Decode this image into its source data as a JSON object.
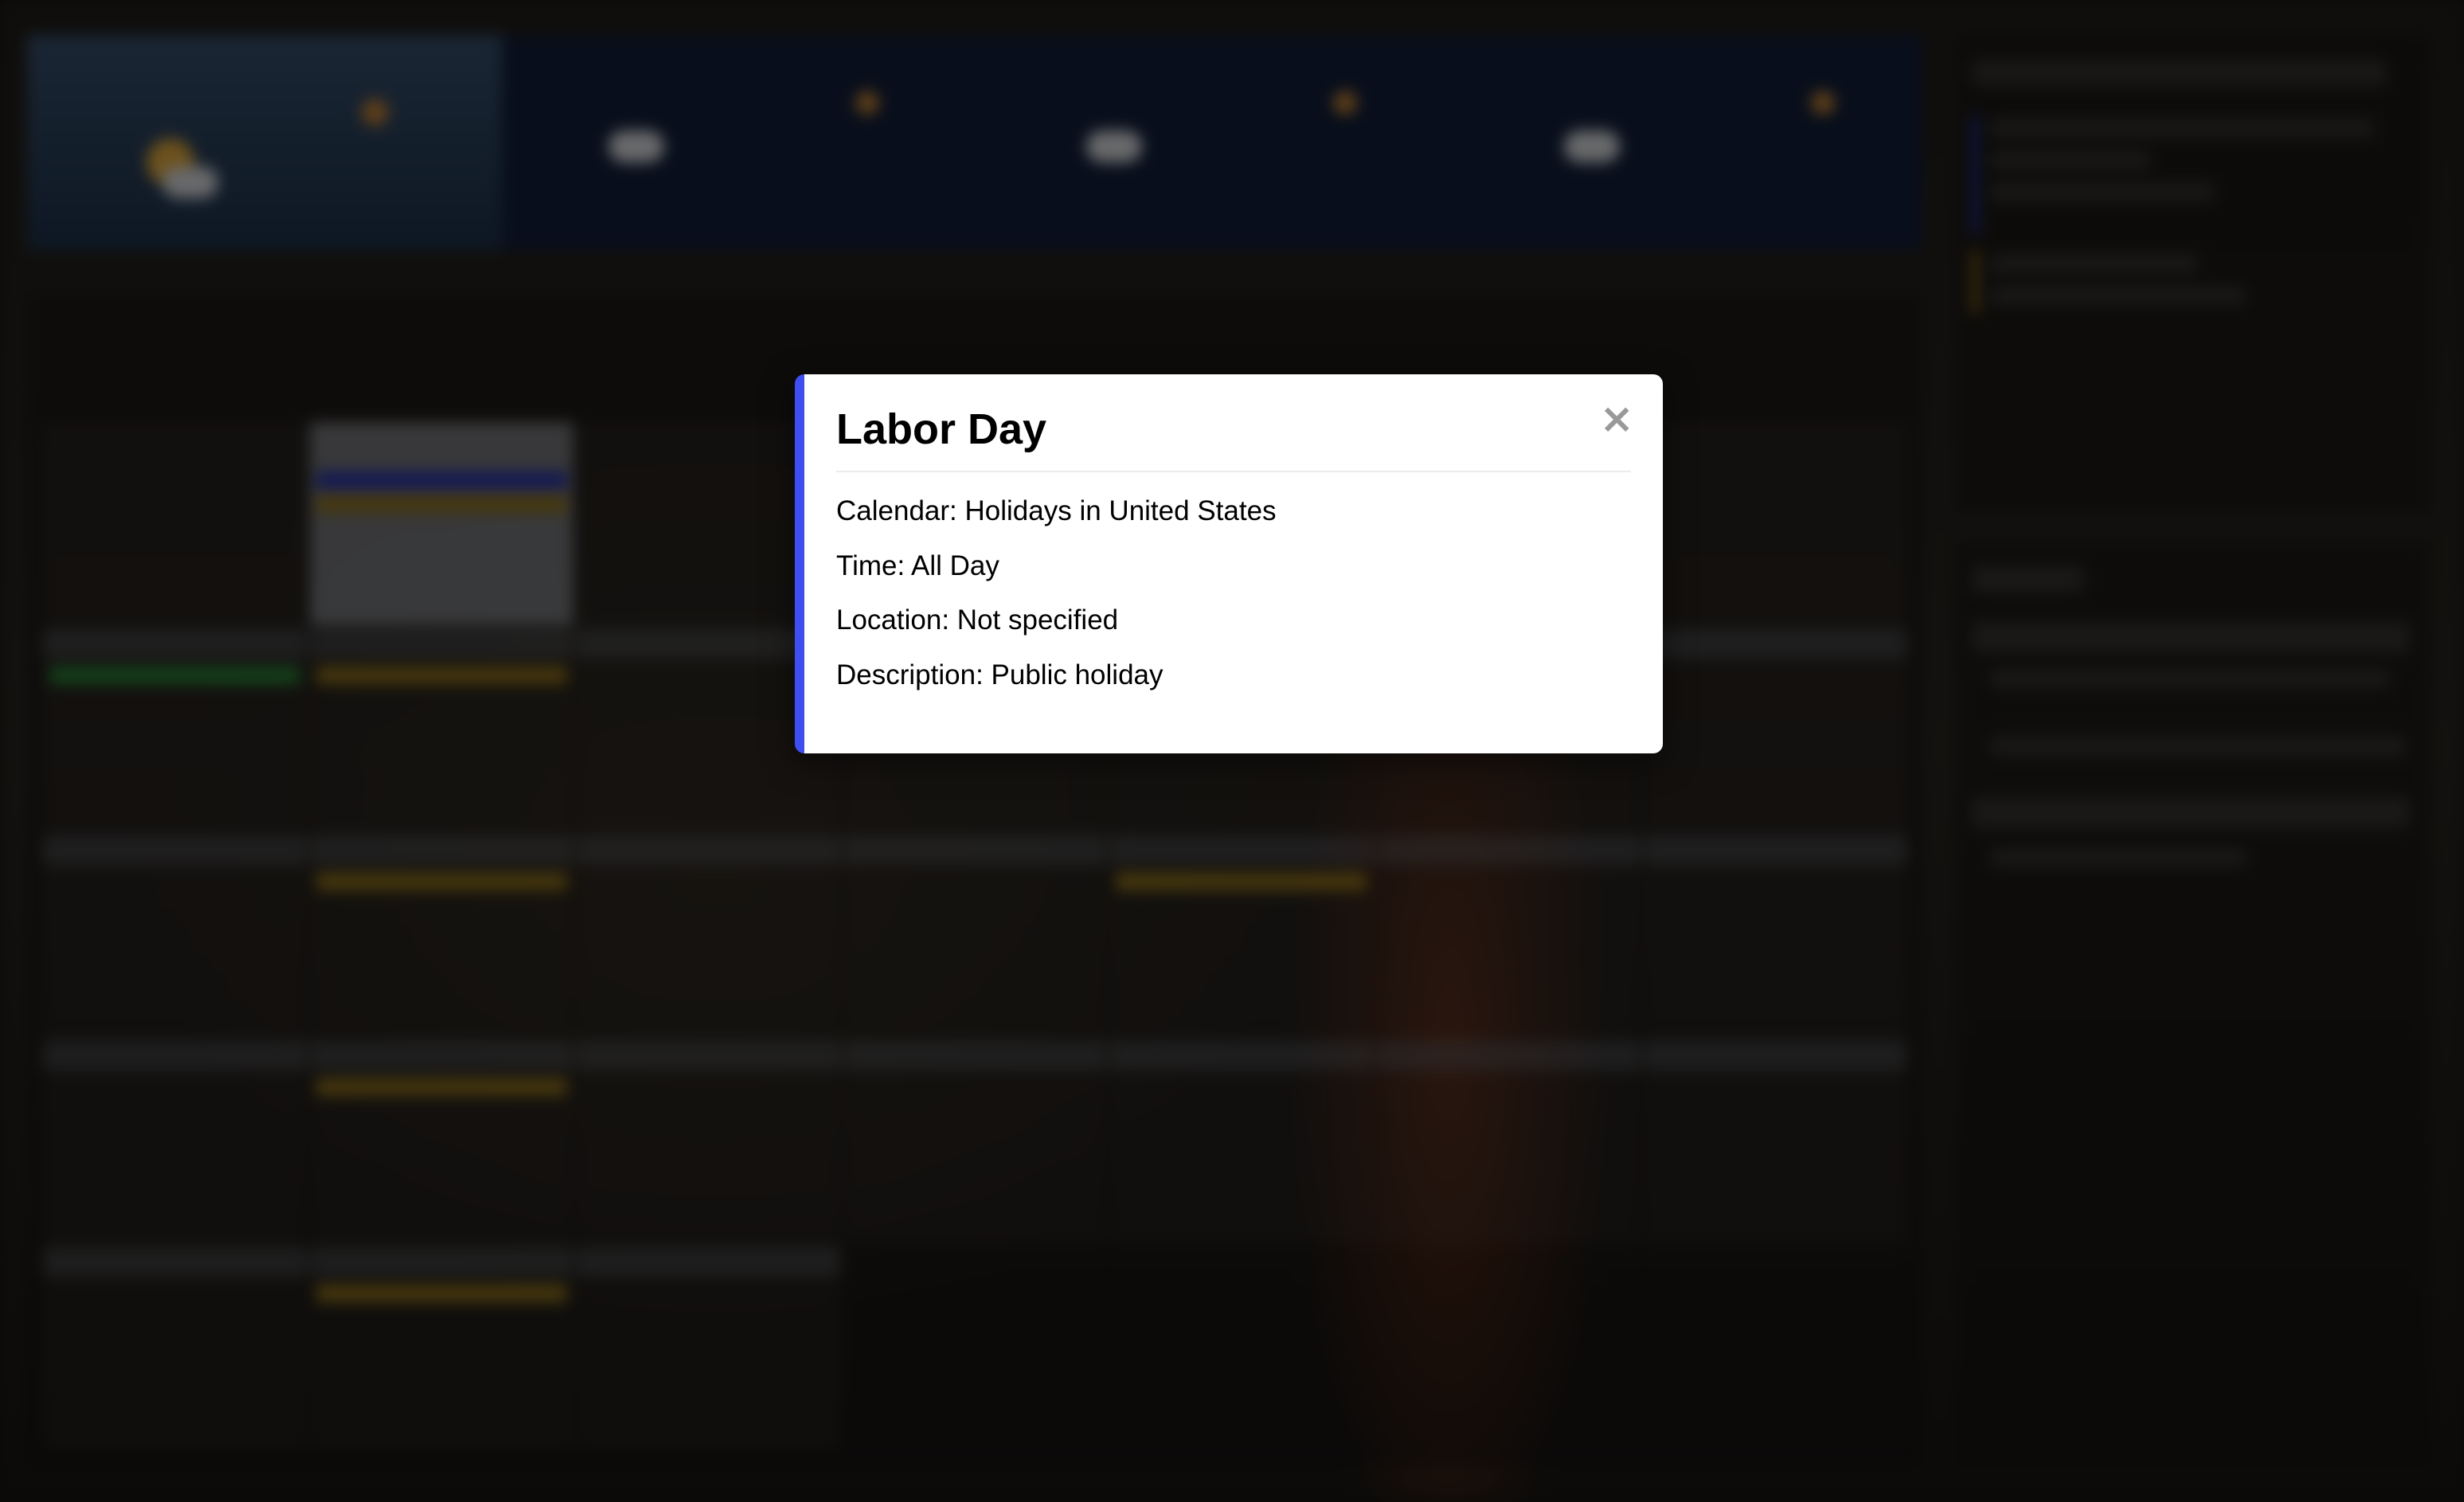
{
  "modal": {
    "title": "Labor Day",
    "close_glyph": "×",
    "accent_color": "#3f4ef0",
    "calendar_label": "Calendar:",
    "calendar_value": "Holidays in United States",
    "time_label": "Time:",
    "time_value": "All Day",
    "location_label": "Location:",
    "location_value": "Not specified",
    "description_label": "Description:",
    "description_value": "Public holiday"
  },
  "background": {
    "blurred": true,
    "event_colors": {
      "holiday": "#2a36b8",
      "family": "#9a7a1d",
      "personal": "#2f8f3a"
    },
    "weather_bar_color": "#13213d",
    "sunset_accent": "#a4451f"
  }
}
